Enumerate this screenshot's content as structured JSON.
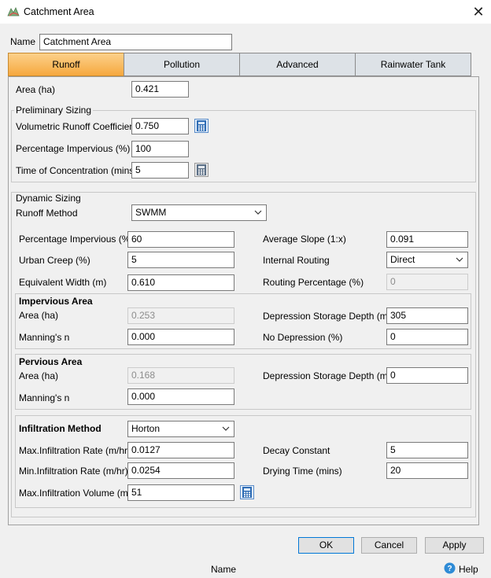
{
  "window": {
    "title": "Catchment Area"
  },
  "name_field": {
    "label": "Name",
    "value": "Catchment Area"
  },
  "tabs": [
    {
      "label": "Runoff",
      "active": true
    },
    {
      "label": "Pollution",
      "active": false
    },
    {
      "label": "Advanced",
      "active": false
    },
    {
      "label": "Rainwater Tank",
      "active": false
    }
  ],
  "area": {
    "label": "Area (ha)",
    "value": "0.421"
  },
  "preliminary": {
    "title": "Preliminary Sizing",
    "runoff_coeff": {
      "label": "Volumetric Runoff Coefficient",
      "value": "0.750"
    },
    "pct_impervious": {
      "label": "Percentage Impervious (%)",
      "value": "100"
    },
    "time_conc": {
      "label": "Time of Concentration (mins)",
      "value": "5"
    }
  },
  "dynamic": {
    "title": "Dynamic Sizing",
    "runoff_method": {
      "label": "Runoff Method",
      "value": "SWMM"
    },
    "pct_impervious": {
      "label": "Percentage Impervious (%)",
      "value": "60"
    },
    "urban_creep": {
      "label": "Urban Creep (%)",
      "value": "5"
    },
    "equiv_width": {
      "label": "Equivalent Width (m)",
      "value": "0.610"
    },
    "avg_slope": {
      "label": "Average Slope (1:x)",
      "value": "0.091"
    },
    "internal_routing": {
      "label": "Internal Routing",
      "value": "Direct"
    },
    "routing_pct": {
      "label": "Routing Percentage (%)",
      "value": "0"
    }
  },
  "impervious": {
    "title": "Impervious Area",
    "area": {
      "label": "Area (ha)",
      "value": "0.253"
    },
    "mannings": {
      "label": "Manning's n",
      "value": "0.000"
    },
    "depression": {
      "label": "Depression Storage Depth (mm)",
      "value": "305"
    },
    "no_depression": {
      "label": "No Depression (%)",
      "value": "0"
    }
  },
  "pervious": {
    "title": "Pervious Area",
    "area": {
      "label": "Area (ha)",
      "value": "0.168"
    },
    "mannings": {
      "label": "Manning's n",
      "value": "0.000"
    },
    "depression": {
      "label": "Depression Storage Depth (mm)",
      "value": "0"
    }
  },
  "infiltration": {
    "title": "Infiltration Method",
    "method": "Horton",
    "max_rate": {
      "label": "Max.Infiltration Rate (m/hr)",
      "value": "0.0127"
    },
    "min_rate": {
      "label": "Min.Infiltration Rate (m/hr)",
      "value": "0.0254"
    },
    "max_volume": {
      "label": "Max.Infiltration Volume (mm)",
      "value": "51"
    },
    "decay": {
      "label": "Decay Constant",
      "value": "5"
    },
    "drying": {
      "label": "Drying Time (mins)",
      "value": "20"
    }
  },
  "buttons": {
    "ok": "OK",
    "cancel": "Cancel",
    "apply": "Apply"
  },
  "status": {
    "text": "Name",
    "help": "Help"
  },
  "colors": {
    "tab_active": "#f6a83e",
    "tab_inactive": "#dde2e7",
    "default_button_border": "#0078d7"
  },
  "icons": {
    "app": "catchment-app-icon",
    "calculator": "calculator-icon",
    "help": "help-icon",
    "close": "close-icon"
  }
}
